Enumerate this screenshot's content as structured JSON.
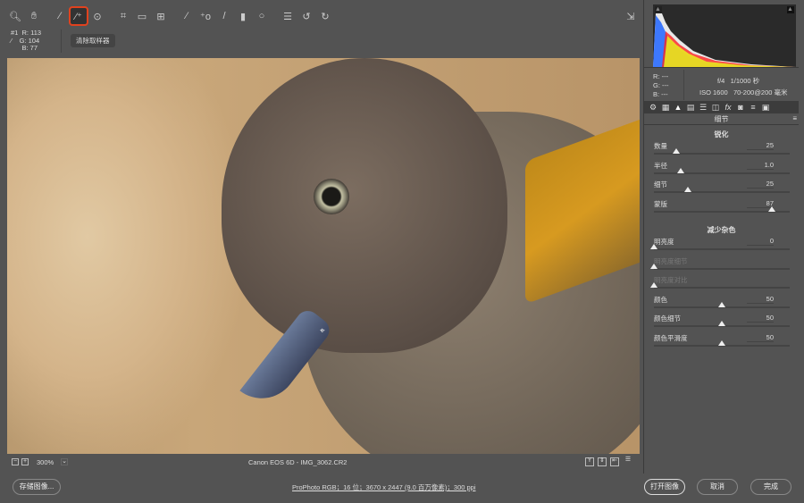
{
  "toolbar": {
    "tools": [
      "zoom-tool",
      "hand-tool",
      "white-balance-tool",
      "color-sampler-tool",
      "targeted-adjustment-tool",
      "crop-tool",
      "straighten-tool",
      "transform-tool",
      "spot-removal-tool",
      "red-eye-tool",
      "adjustment-brush",
      "graduated-filter",
      "radial-filter",
      "presets-list",
      "rotate-left",
      "rotate-right"
    ],
    "active_tool": "color-sampler-tool",
    "accent": "#e0421e"
  },
  "sampler": {
    "id": "#1",
    "r": "R:  113",
    "g": "G:  104",
    "b": "B:   77",
    "clear_label": "清除取样器"
  },
  "statusbar": {
    "zoom": "300%",
    "filename": "Canon EOS 6D -  IMG_3062.CR2"
  },
  "info": {
    "r": "R:  ---",
    "g": "G:  ---",
    "b": "B:  ---",
    "aperture": "f/4",
    "shutter": "1/1000 秒",
    "iso": "ISO 1600",
    "lens": "70-200@200 毫米"
  },
  "panel": {
    "title": "细节",
    "sharpen_title": "锐化",
    "noise_title": "减少杂色",
    "sharpen": [
      {
        "label": "数量",
        "value": "25",
        "pos": 0.167
      },
      {
        "label": "半径",
        "value": "1.0",
        "pos": 0.2
      },
      {
        "label": "细节",
        "value": "25",
        "pos": 0.25
      },
      {
        "label": "蒙版",
        "value": "87",
        "pos": 0.87
      }
    ],
    "noise": [
      {
        "label": "明亮度",
        "value": "0",
        "pos": 0
      },
      {
        "label": "明亮度细节",
        "value": "",
        "pos": 0,
        "disabled": true
      },
      {
        "label": "明亮度对比",
        "value": "",
        "pos": 0,
        "disabled": true
      },
      {
        "label": "颜色",
        "value": "50",
        "pos": 0.5
      },
      {
        "label": "颜色细节",
        "value": "50",
        "pos": 0.5
      },
      {
        "label": "颜色平滑度",
        "value": "50",
        "pos": 0.5
      }
    ]
  },
  "bottom": {
    "save": "存储图像...",
    "workflow": "ProPhoto RGB；16 位；3670 x 2447 (9.0 百万像素)；300 ppi",
    "open": "打开图像",
    "cancel": "取消",
    "done": "完成"
  }
}
